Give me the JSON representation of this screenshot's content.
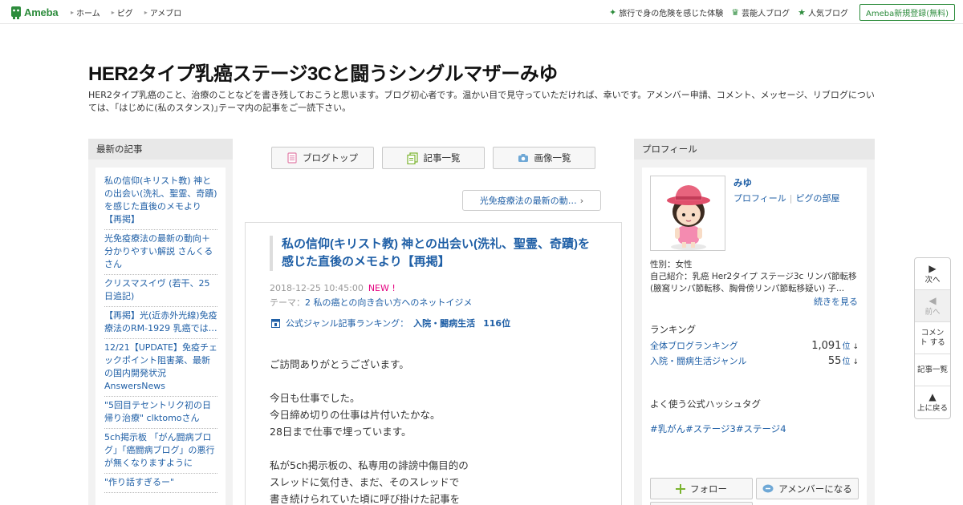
{
  "topbar": {
    "logo": "Ameba",
    "nav": [
      "ホーム",
      "ピグ",
      "アメブロ"
    ],
    "right_links": [
      {
        "label": "旅行で身の危険を感じた体験",
        "icon": "diamond-icon"
      },
      {
        "label": "芸能人ブログ",
        "icon": "crown-icon"
      },
      {
        "label": "人気ブログ",
        "icon": "star-icon"
      }
    ],
    "register": "Ameba新規登録(無料)"
  },
  "blog": {
    "title": "HER2タイプ乳癌ステージ3Cと闘うシングルマザーみゆ",
    "description": "HER2タイプ乳癌のこと、治療のことなどを書き残しておこうと思います。ブログ初心者です。温かい目で見守っていただければ、幸いです。アメンバー申請、コメント、メッセージ、リブログについては、｢はじめに(私のスタンス)｣テーマ内の記事をご一読下さい。"
  },
  "sidebar_left": {
    "heading": "最新の記事",
    "entries": [
      "私の信仰(キリスト教) 神との出会い(洗礼、聖霊、奇蹟)を感じた直後のメモより【再掲】",
      "光免疫療法の最新の動向＋分かりやすい解説 さんくるさん",
      "クリスマスイヴ (若干、25日追記)",
      "【再掲】光(近赤外光線)免疫療法のRM-1929 乳癌では…",
      "12/21【UPDATE】免疫チェックポイント阻害薬、最新の国内開発状況 AnswersNews",
      "\"5回目テセントリク初の日帰り治療\" clktomoさん",
      "5ch掲示板 「がん闘病ブログ」「癌闘病ブログ」の悪行が無くなりますように",
      "\"作り話すぎるー\""
    ]
  },
  "tabs": [
    {
      "label": "ブログトップ",
      "icon": "document-icon"
    },
    {
      "label": "記事一覧",
      "icon": "list-icon"
    },
    {
      "label": "画像一覧",
      "icon": "camera-icon"
    }
  ],
  "prev_article": "光免疫療法の最新の動…",
  "article": {
    "title": "私の信仰(キリスト教) 神との出会い(洗礼、聖霊、奇蹟)を感じた直後のメモより【再掲】",
    "datetime": "2018-12-25 10:45:00",
    "new_badge": "NEW !",
    "theme_label": "テーマ：",
    "theme": "2 私の癌との向き合い方へのネットイジメ",
    "ranking_label": "公式ジャンル記事ランキング：",
    "ranking_genre": "入院・闘病生活",
    "ranking_position": "116位",
    "body": [
      "ご訪問ありがとうございます。",
      "",
      "今日も仕事でした。",
      "今日締め切りの仕事は片付いたかな。",
      "28日まで仕事で埋っています。",
      "",
      "私が5ch掲示板の、私専用の誹謗中傷目的の",
      "スレッドに気付き、まだ、そのスレッドで",
      "書き続けられていた頃に呼び掛けた記事を"
    ]
  },
  "profile": {
    "heading": "プロフィール",
    "name": "みゆ",
    "link_profile": "プロフィール",
    "link_room": "ピグの部屋",
    "gender": "性別：女性",
    "intro": "自己紹介：乳癌 Her2タイプ ステージ3c リンパ節転移 (腋窩リンパ節転移、胸骨傍リンパ節転移疑い) 子...",
    "more": "続きを見る",
    "ranking_heading": "ランキング",
    "rankings": [
      {
        "label": "全体ブログランキング",
        "value": "1,091",
        "unit": "位",
        "trend": "↓"
      },
      {
        "label": "入院・闘病生活ジャンル",
        "value": "55",
        "unit": "位",
        "trend": "↓"
      }
    ],
    "hashtag_heading": "よく使う公式ハッシュタグ",
    "hashtags": [
      "#乳がん",
      "#ステージ3",
      "#ステージ4"
    ],
    "follow": "フォロー",
    "amember": "アメンバーになる"
  },
  "sidenav": [
    {
      "label": "次へ",
      "glyph": "▶",
      "disabled": false
    },
    {
      "label": "前へ",
      "glyph": "◀",
      "disabled": true
    },
    {
      "label": "コメント する",
      "glyph": "",
      "disabled": false
    },
    {
      "label": "記事一覧",
      "glyph": "",
      "disabled": false
    },
    {
      "label": "上に戻る",
      "glyph": "▲",
      "disabled": false
    }
  ],
  "colors": {
    "brand_green": "#2d8c3c",
    "link_blue": "#1f5fa6",
    "new_pink": "#e4007f",
    "panel_gray": "#f2f2f2"
  }
}
